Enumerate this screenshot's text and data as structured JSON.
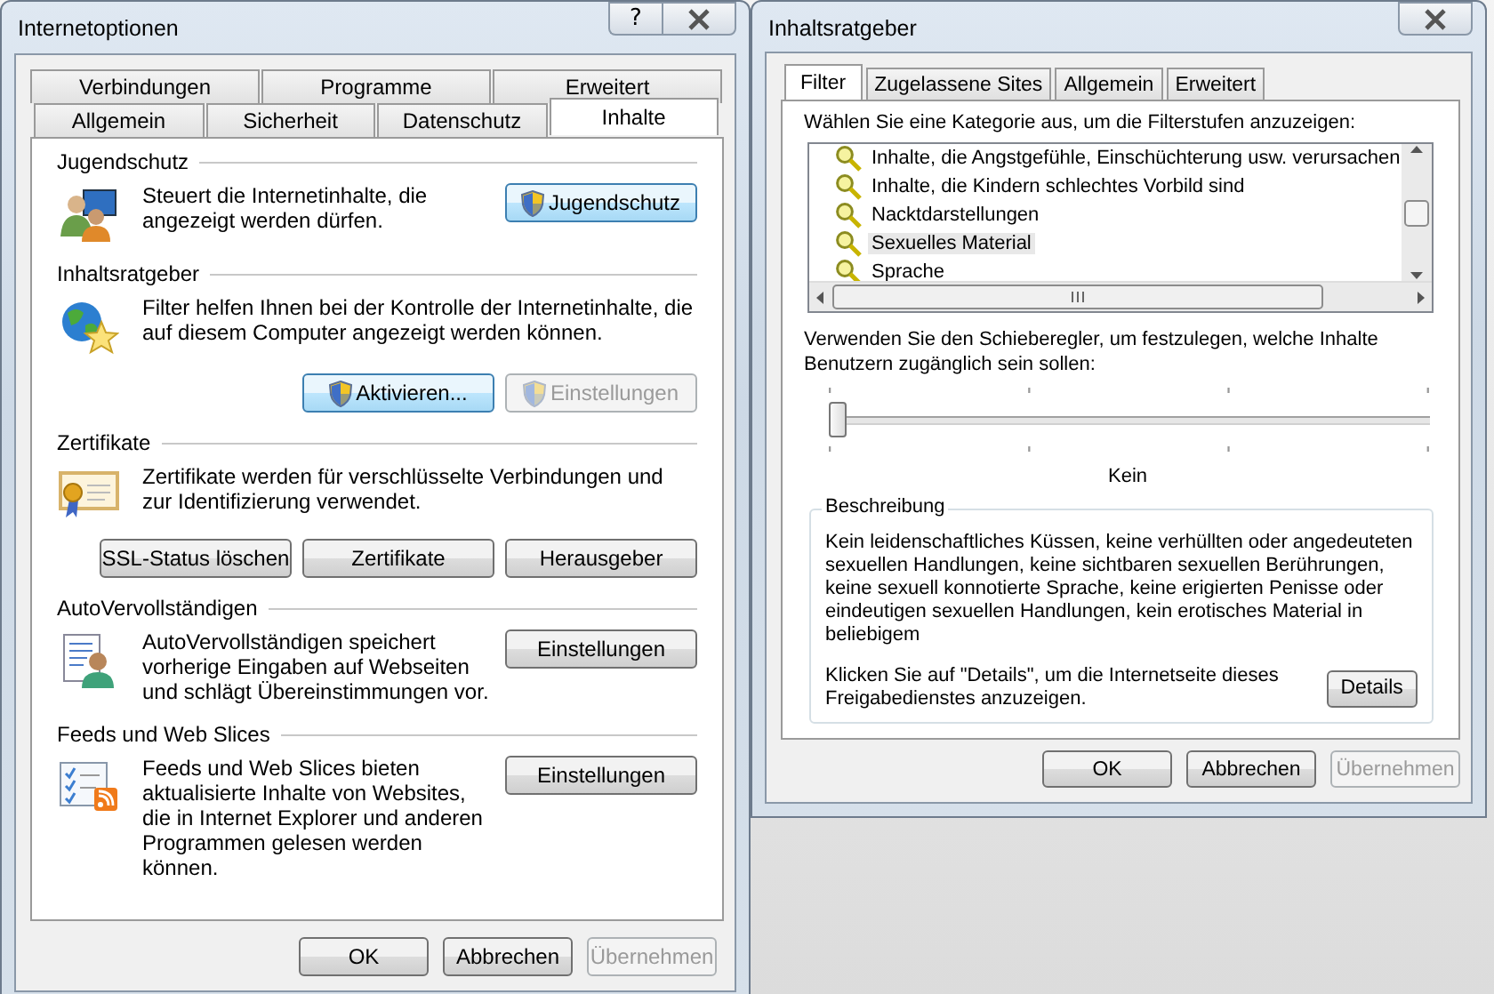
{
  "internet_options": {
    "title": "Internetoptionen",
    "help_button": "?",
    "tab_rows": [
      [
        {
          "label": "Verbindungen",
          "selected": false
        },
        {
          "label": "Programme",
          "selected": false
        },
        {
          "label": "Erweitert",
          "selected": false
        }
      ],
      [
        {
          "label": "Allgemein",
          "selected": false
        },
        {
          "label": "Sicherheit",
          "selected": false
        },
        {
          "label": "Datenschutz",
          "selected": false
        },
        {
          "label": "Inhalte",
          "selected": true
        }
      ]
    ],
    "sections": [
      {
        "heading": "Jugendschutz",
        "kind": "parental",
        "text": "Steuert die Internetinhalte, die angezeigt werden dürfen.",
        "buttons": [
          {
            "label": "Jugendschutz",
            "shield": true,
            "disabled": false
          }
        ]
      },
      {
        "heading": "Inhaltsratgeber",
        "kind": "globe",
        "text": "Filter helfen Ihnen bei der Kontrolle der Internetinhalte, die auf diesem Computer angezeigt werden können.",
        "buttons": [
          {
            "label": "Aktivieren...",
            "shield": true,
            "disabled": false
          },
          {
            "label": "Einstellungen",
            "shield": true,
            "disabled": true
          }
        ]
      },
      {
        "heading": "Zertifikate",
        "kind": "certificate",
        "text": "Zertifikate werden für verschlüsselte Verbindungen und zur Identifizierung verwendet.",
        "buttons": [
          {
            "label": "SSL-Status löschen",
            "shield": false,
            "disabled": false
          },
          {
            "label": "Zertifikate",
            "shield": false,
            "disabled": false
          },
          {
            "label": "Herausgeber",
            "shield": false,
            "disabled": false
          }
        ]
      },
      {
        "heading": "AutoVervollständigen",
        "kind": "autocomplete",
        "text": "AutoVervollständigen speichert vorherige Eingaben auf Webseiten und schlägt Übereinstimmungen vor.",
        "buttons": [
          {
            "label": "Einstellungen",
            "shield": false,
            "disabled": false
          }
        ]
      },
      {
        "heading": "Feeds und Web Slices",
        "kind": "feeds",
        "text": "Feeds und Web Slices bieten aktualisierte Inhalte von Websites, die in Internet Explorer und anderen Programmen gelesen werden können.",
        "buttons": [
          {
            "label": "Einstellungen",
            "shield": false,
            "disabled": false
          }
        ]
      }
    ],
    "buttons": [
      {
        "label": "OK",
        "disabled": false
      },
      {
        "label": "Abbrechen",
        "disabled": false
      },
      {
        "label": "Übernehmen",
        "disabled": true
      }
    ]
  },
  "content_advisor": {
    "title": "Inhaltsratgeber",
    "tabs": [
      {
        "label": "Filter",
        "selected": true
      },
      {
        "label": "Zugelassene Sites",
        "selected": false
      },
      {
        "label": "Allgemein",
        "selected": false
      },
      {
        "label": "Erweitert",
        "selected": false
      }
    ],
    "prompt": "Wählen Sie eine Kategorie aus, um die Filterstufen anzuzeigen:",
    "categories": [
      {
        "label": "Inhalte, die Angstgefühle, Einschüchterung usw. verursachen",
        "selected": false
      },
      {
        "label": "Inhalte, die Kindern schlechtes Vorbild sind",
        "selected": false
      },
      {
        "label": "Nacktdarstellungen",
        "selected": false
      },
      {
        "label": "Sexuelles Material",
        "selected": true
      },
      {
        "label": "Sprache",
        "selected": false
      }
    ],
    "slider_prompt": "Verwenden Sie den Schieberegler, um festzulegen, welche Inhalte Benutzern zugänglich sein sollen:",
    "slider": {
      "level": 0
    },
    "rating": "Kein",
    "description": {
      "heading": "Beschreibung",
      "text": "Kein leidenschaftliches Küssen, keine verhüllten oder angedeuteten sexuellen Handlungen, keine sichtbaren sexuellen Berührungen, keine sexuell konnotierte Sprache, keine erigierten Penisse oder eindeutigen sexuellen Handlungen, kein erotisches Material in beliebigem",
      "details_text": "Klicken Sie auf \"Details\", um die Internetseite dieses Freigabedienstes anzuzeigen.",
      "details_button": "Details"
    },
    "buttons": [
      {
        "label": "OK",
        "disabled": false
      },
      {
        "label": "Abbrechen",
        "disabled": false
      },
      {
        "label": "Übernehmen",
        "disabled": true
      }
    ]
  }
}
